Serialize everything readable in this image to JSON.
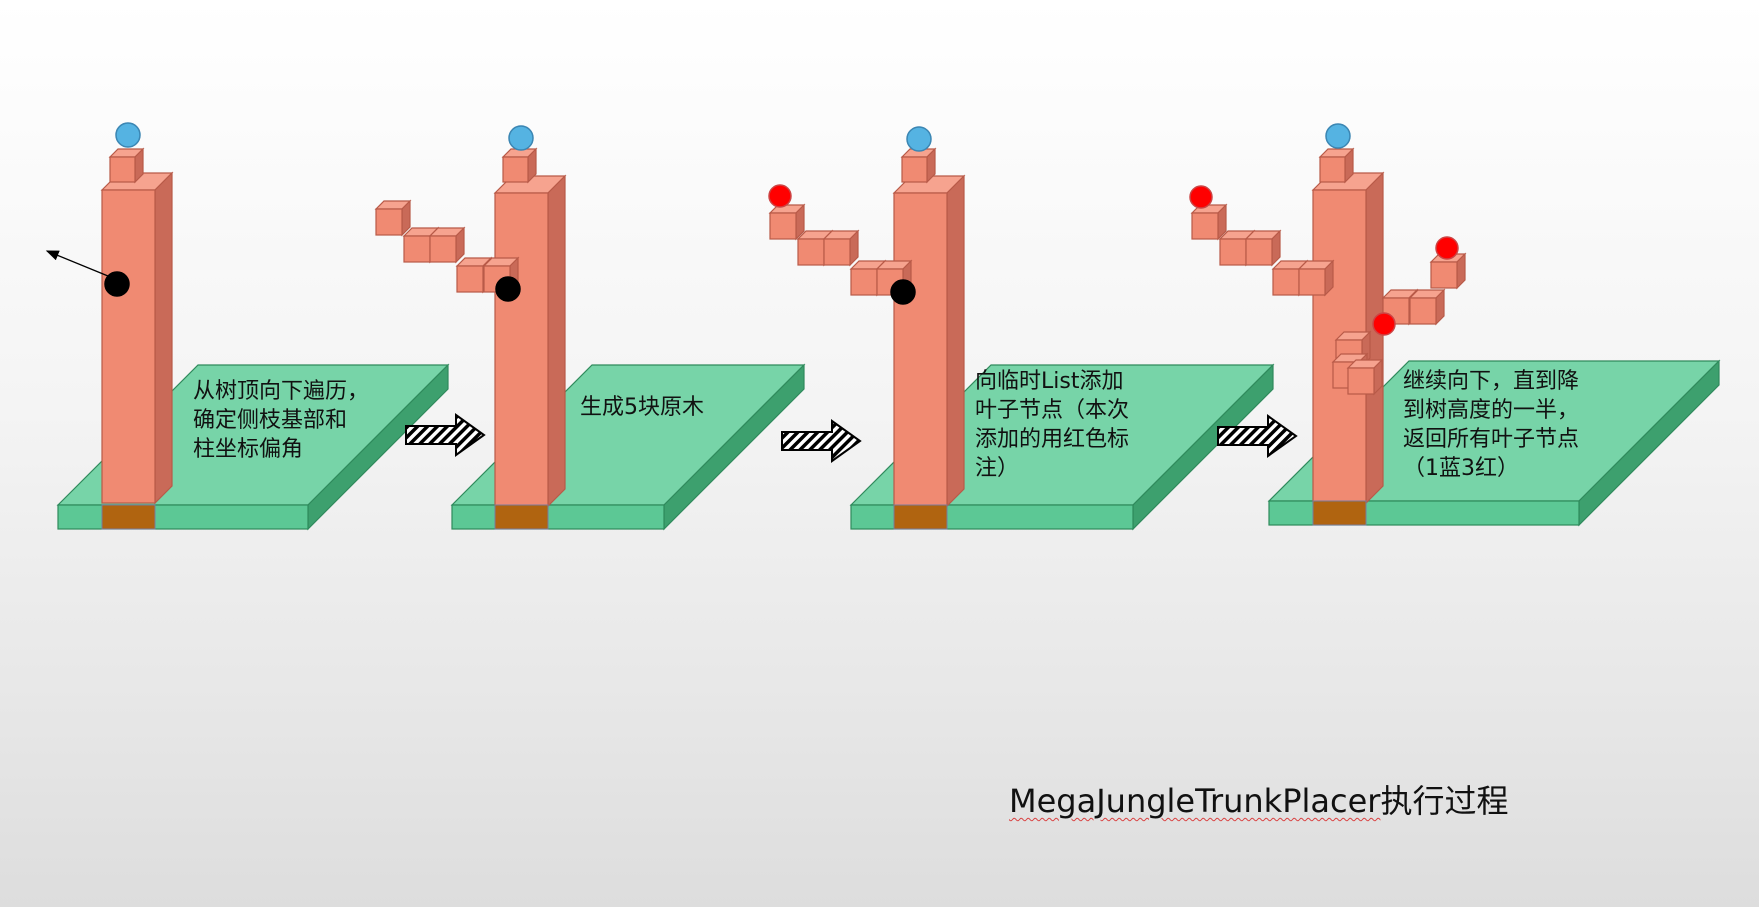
{
  "caption": {
    "en": "MegaJungleTrunkPlacer",
    "zh": "执行过程"
  },
  "steps": [
    {
      "id": "step1",
      "lines": [
        "从树顶向下遍历，",
        "确定侧枝基部和",
        "柱坐标偏角"
      ]
    },
    {
      "id": "step2",
      "lines": [
        "生成5块原木"
      ]
    },
    {
      "id": "step3",
      "lines": [
        "向临时List添加",
        "叶子节点（本次",
        "添加的用红色标",
        "注）"
      ]
    },
    {
      "id": "step4",
      "lines": [
        "继续向下，直到降",
        "到树高度的一半，",
        "返回所有叶子节点",
        "（1蓝3红）"
      ]
    }
  ],
  "colors": {
    "trunk": "#F08A72",
    "trunk_side": "#C96A58",
    "trunk_top": "#F6A38F",
    "trunk_border": "#B85A48",
    "ground": "#77D4A8",
    "ground_side": "#3DA06E",
    "ground_front": "#5CC895",
    "ground_border": "#2F8A5C",
    "dirt": "#B06410",
    "leaf_blue": "#55B3E2",
    "leaf_red": "#FF0000",
    "marker": "#000000"
  },
  "icons": {
    "arrow": "hatched-right-arrow-icon",
    "leaf_node": "circle-node-icon",
    "cursor_marker": "black-dot-marker-icon"
  }
}
